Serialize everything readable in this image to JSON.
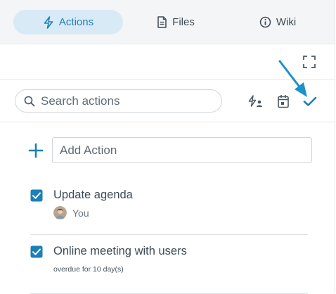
{
  "tabs": [
    {
      "label": "Actions",
      "icon": "bolt-icon",
      "active": true
    },
    {
      "label": "Files",
      "icon": "file-icon",
      "active": false
    },
    {
      "label": "Wiki",
      "icon": "info-icon",
      "active": false
    }
  ],
  "toolbar": {
    "expand_icon": "expand-icon"
  },
  "search": {
    "placeholder": "Search actions"
  },
  "filters": [
    {
      "icon": "assigned-bolt-icon",
      "active": false
    },
    {
      "icon": "calendar-icon",
      "active": false
    },
    {
      "icon": "checkmark-icon",
      "active": true
    }
  ],
  "add_action": {
    "placeholder": "Add Action"
  },
  "actions": [
    {
      "title": "Update agenda",
      "checked": true,
      "assignee": "You"
    },
    {
      "title": "Online meeting with users",
      "checked": true,
      "status": "overdue for 10 day(s)"
    }
  ],
  "colors": {
    "accent": "#1b7fb8",
    "tab_active_bg": "#d8eaf6",
    "annotation_arrow": "#1e91c8"
  }
}
